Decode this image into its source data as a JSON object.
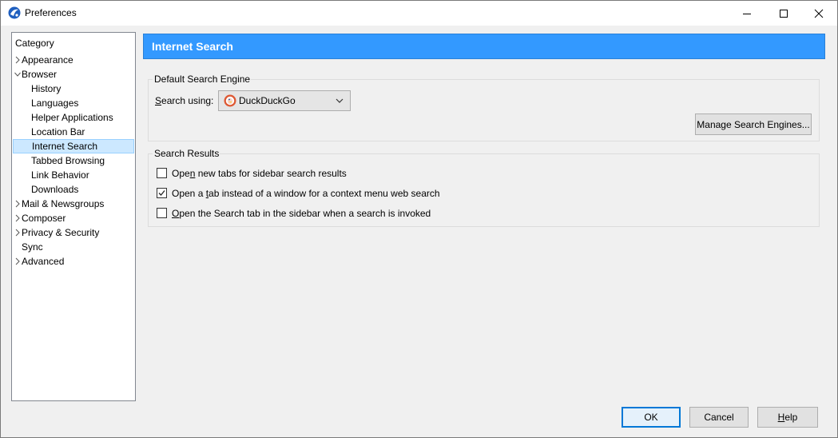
{
  "window": {
    "title": "Preferences",
    "minimize_glyph": "–",
    "maximize_glyph": "□",
    "close_glyph": "✕"
  },
  "category": {
    "header": "Category",
    "items": [
      {
        "label": "Appearance",
        "level": 0,
        "expander": "collapsed"
      },
      {
        "label": "Browser",
        "level": 0,
        "expander": "expanded"
      },
      {
        "label": "History",
        "level": 1
      },
      {
        "label": "Languages",
        "level": 1
      },
      {
        "label": "Helper Applications",
        "level": 1
      },
      {
        "label": "Location Bar",
        "level": 1
      },
      {
        "label": "Internet Search",
        "level": 1,
        "selected": true
      },
      {
        "label": "Tabbed Browsing",
        "level": 1
      },
      {
        "label": "Link Behavior",
        "level": 1
      },
      {
        "label": "Downloads",
        "level": 1
      },
      {
        "label": "Mail & Newsgroups",
        "level": 0,
        "expander": "collapsed"
      },
      {
        "label": "Composer",
        "level": 0,
        "expander": "collapsed"
      },
      {
        "label": "Privacy & Security",
        "level": 0,
        "expander": "collapsed"
      },
      {
        "label": "Sync",
        "level": 0
      },
      {
        "label": "Advanced",
        "level": 0,
        "expander": "collapsed"
      }
    ]
  },
  "panel": {
    "title": "Internet Search",
    "default_engine": {
      "group_label": "Default Search Engine",
      "search_using_prefix": "S",
      "search_using_rest": "earch using:",
      "selected_engine": "DuckDuckGo",
      "manage_button": "Manage Search Engines..."
    },
    "search_results": {
      "group_label": "Search Results",
      "options": [
        {
          "pre": "Ope",
          "u": "n",
          "post": " new tabs for sidebar search results",
          "checked": false
        },
        {
          "pre": "Open a ",
          "u": "t",
          "post": "ab instead of a window for a context menu web search",
          "checked": true
        },
        {
          "pre": "",
          "u": "O",
          "post": "pen the Search tab in the sidebar when a search is invoked",
          "checked": false
        }
      ]
    }
  },
  "footer": {
    "ok": "OK",
    "cancel": "Cancel",
    "help_u": "H",
    "help_rest": "elp"
  },
  "colors": {
    "accent": "#3399ff",
    "selection": "#cce8ff",
    "default_button_border": "#0078d7"
  }
}
